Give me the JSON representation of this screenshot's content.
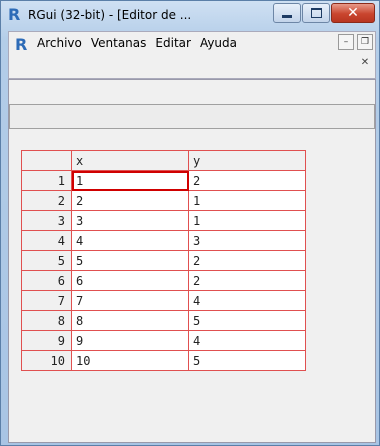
{
  "window": {
    "title": "RGui (32-bit) - [Editor de ...",
    "icon": "r-logo-icon"
  },
  "menu": {
    "items": [
      "Archivo",
      "Ventanas",
      "Editar",
      "Ayuda"
    ]
  },
  "grid": {
    "columns": [
      "x",
      "y"
    ],
    "rows": [
      {
        "n": "1",
        "x": "1",
        "y": "2"
      },
      {
        "n": "2",
        "x": "2",
        "y": "1"
      },
      {
        "n": "3",
        "x": "3",
        "y": "1"
      },
      {
        "n": "4",
        "x": "4",
        "y": "3"
      },
      {
        "n": "5",
        "x": "5",
        "y": "2"
      },
      {
        "n": "6",
        "x": "6",
        "y": "2"
      },
      {
        "n": "7",
        "x": "7",
        "y": "4"
      },
      {
        "n": "8",
        "x": "8",
        "y": "5"
      },
      {
        "n": "9",
        "x": "9",
        "y": "4"
      },
      {
        "n": "10",
        "x": "10",
        "y": "5"
      }
    ]
  },
  "colors": {
    "grid_border": "#e05050",
    "r_logo": "#2d6bb7"
  }
}
